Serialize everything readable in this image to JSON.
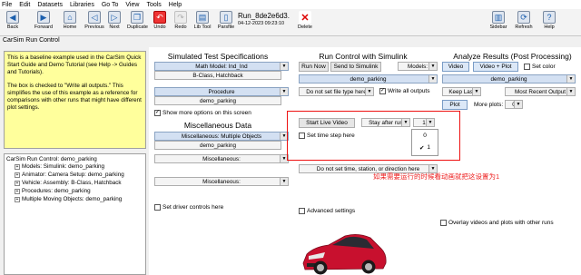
{
  "menu": [
    "File",
    "Edit",
    "Datasets",
    "Libraries",
    "Go To",
    "View",
    "Tools",
    "Help"
  ],
  "toolbar": {
    "back": "Back",
    "forward": "Forward",
    "home": "Home",
    "previous": "Previous",
    "next": "Next",
    "duplicate": "Duplicate",
    "undo": "Undo",
    "redo": "Redo",
    "lib_tool": "Lib Tool",
    "parsfile": "Parsfile",
    "delete": "Delete",
    "sidebar": "Sidebar",
    "refresh": "Refresh",
    "help": "Help"
  },
  "run": {
    "name": "Run_8de2e6d3.",
    "date": "04-12-2023 09:23:10"
  },
  "title": "CarSim Run Control",
  "description": "This is a baseline example used in the CarSim Quick Start Guide and Demo Tutorial (see Help -> Guides and Tutorials).\n\nThe box is checked to \"Write all outputs.\" This simplifies the use of this example as a reference for comparisons with other runs that might have different plot settings.",
  "tree": {
    "root": "CarSim Run Control: demo_parking",
    "items": [
      "Models: Simulink: demo_parking",
      "Animator: Camera Setup: demo_parking",
      "Vehicle: Assembly: B-Class, Hatchback",
      "Procedures: demo_parking",
      "Multiple Moving Objects: demo_parking"
    ]
  },
  "test_specs": {
    "title": "Simulated Test Specifications",
    "math_model": "Math Model: Ind_Ind",
    "vehicle": "B-Class, Hatchback",
    "procedure_label": "Procedure",
    "procedure_value": "demo_parking",
    "show_more": "Show more options on this screen"
  },
  "misc": {
    "title": "Miscellaneous Data",
    "multi_objects": "Miscellaneous: Multiple Objects",
    "multi_value": "demo_parking",
    "misc1": "Miscellaneous:",
    "misc2": "Miscellaneous:",
    "driver_controls": "Set driver controls here"
  },
  "run_control": {
    "title": "Run Control with Simulink",
    "run_now": "Run Now",
    "send": "Send to Simulink",
    "models": "Models:",
    "model_value": "demo_parking",
    "file_type": "Do not set file type here",
    "write_outputs": "Write all outputs",
    "start_live": "Start Live Video",
    "stay_after": "Stay after run",
    "stay_value": "1",
    "popup_options": [
      "0",
      "1"
    ],
    "time_step": "Set time step here",
    "no_time": "Do not set time, station, or direction here",
    "advanced": "Advanced settings"
  },
  "analyze": {
    "title": "Analyze Results (Post Processing)",
    "video": "Video",
    "video_plot": "Video + Plot",
    "set_color": "Set color",
    "value": "demo_parking",
    "keep_last": "Keep Last",
    "most_recent": "Most Recent Output",
    "plot": "Plot",
    "more_plots": "More plots:",
    "more_plots_value": "0",
    "overlay": "Overlay videos and plots with other runs"
  },
  "annotation": "如果需要运行的时候看动画就把这设置为1",
  "colors": {
    "accent": "#1b5fae",
    "annotation": "#e22222",
    "description_bg": "#ffff9c",
    "car": "#c8102e"
  }
}
